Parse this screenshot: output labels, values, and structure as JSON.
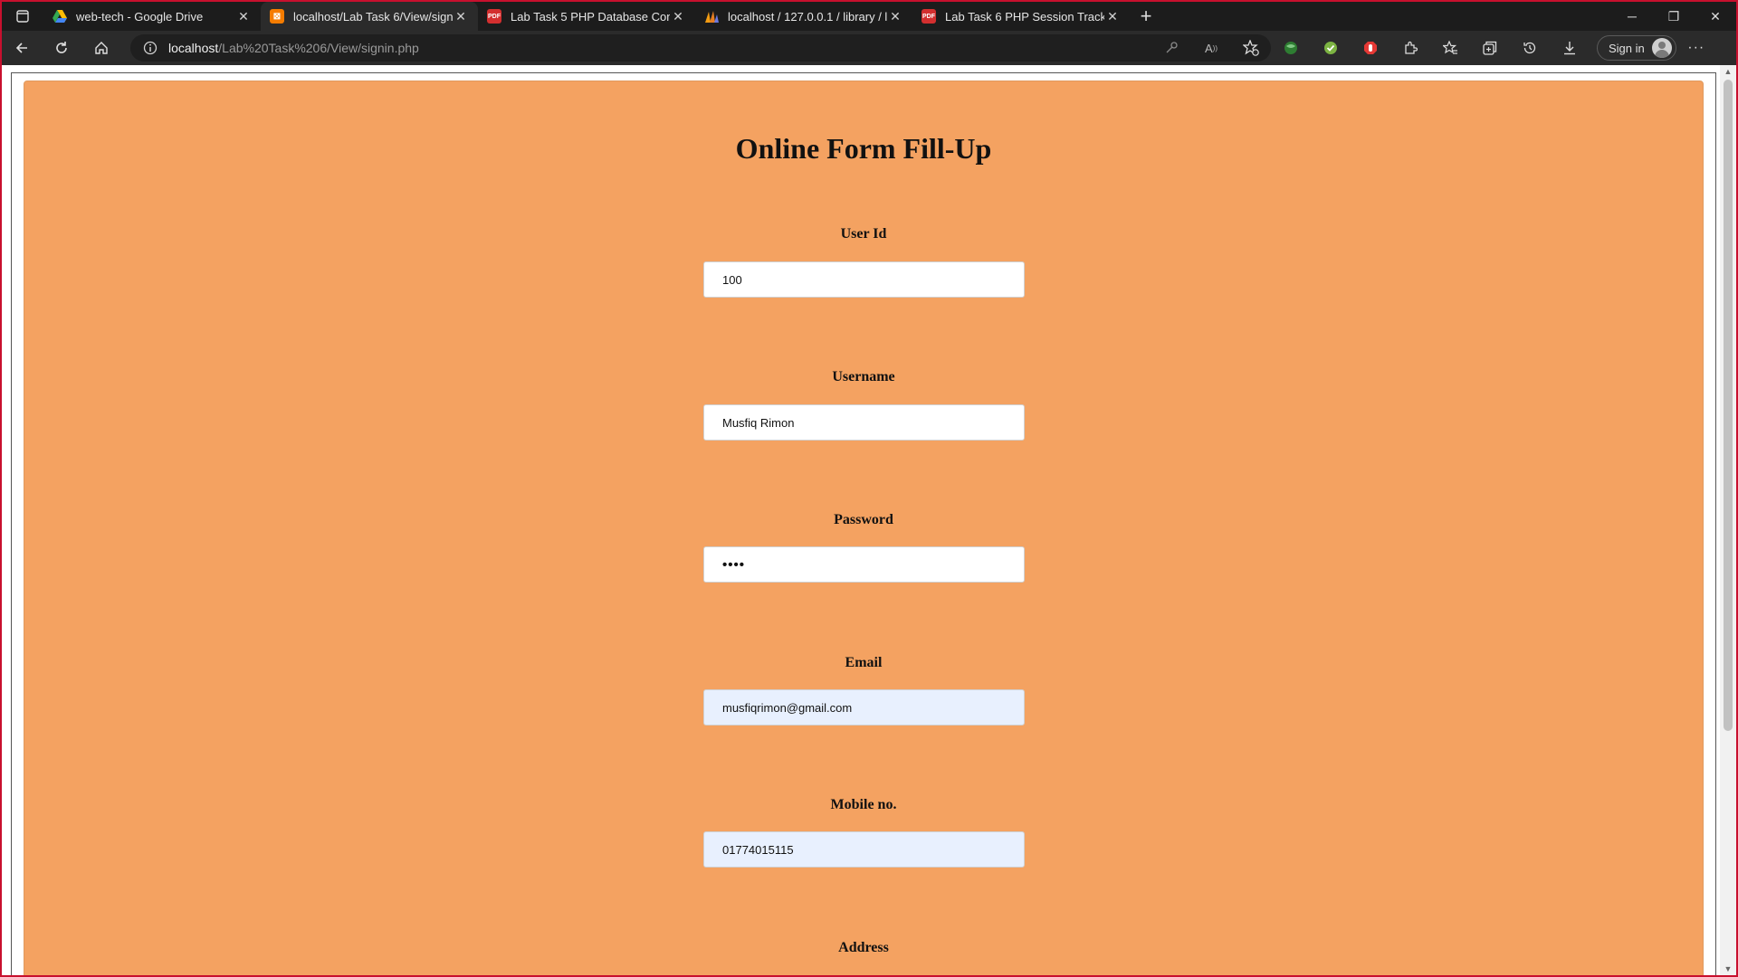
{
  "tabs": [
    {
      "title": "web-tech - Google Drive",
      "icon": "google-drive-icon",
      "active": false
    },
    {
      "title": "localhost/Lab Task 6/View/signin",
      "icon": "xampp-icon",
      "active": true
    },
    {
      "title": "Lab Task 5 PHP Database Conne",
      "icon": "pdf-icon",
      "active": false
    },
    {
      "title": "localhost / 127.0.0.1 / library / lib",
      "icon": "phpmyadmin-icon",
      "active": false
    },
    {
      "title": "Lab Task 6 PHP Session Tracking",
      "icon": "pdf-icon",
      "active": false
    }
  ],
  "address": {
    "host": "localhost",
    "path": "/Lab%20Task%206/View/signin.php"
  },
  "toolbar": {
    "signin_label": "Sign in"
  },
  "form": {
    "title": "Online Form Fill-Up",
    "fields": [
      {
        "label": "User Id",
        "value": "100"
      },
      {
        "label": "Username",
        "value": "Musfiq Rimon"
      },
      {
        "label": "Password",
        "value": "••••"
      },
      {
        "label": "Email",
        "value": "musfiqrimon@gmail.com"
      },
      {
        "label": "Mobile no.",
        "value": "01774015115"
      },
      {
        "label": "Address",
        "value": ""
      }
    ]
  },
  "colors": {
    "page_bg": "#f4a261",
    "autofill_bg": "#e8f0fe",
    "window_border": "#c8102e"
  }
}
